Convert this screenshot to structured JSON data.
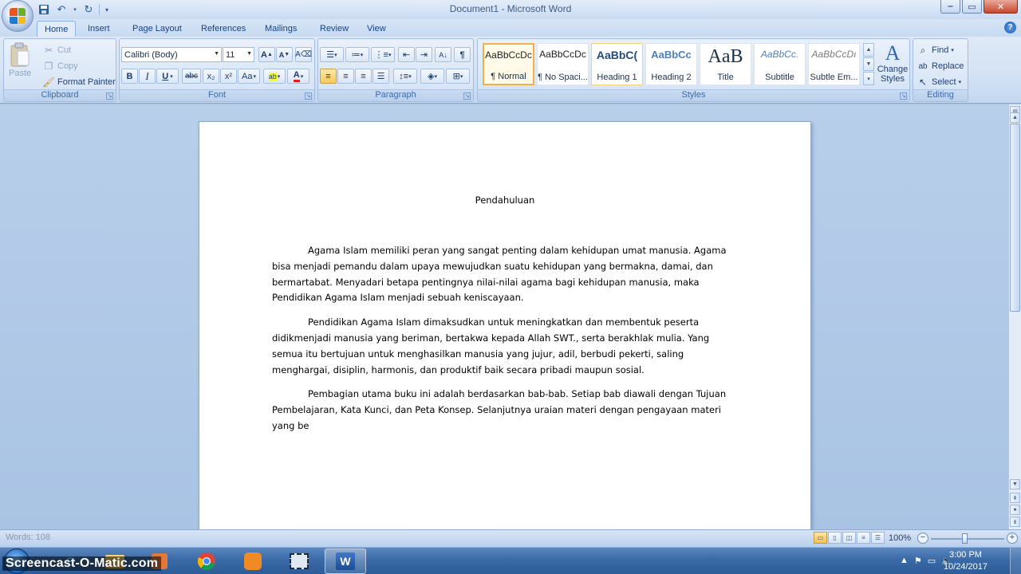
{
  "window": {
    "title": "Document1 - Microsoft Word",
    "minimize": "‒",
    "maximize": "▭",
    "close": "✕"
  },
  "tabs": [
    "Home",
    "Insert",
    "Page Layout",
    "References",
    "Mailings",
    "Review",
    "View"
  ],
  "active_tab": "Home",
  "ribbon": {
    "clipboard": {
      "label": "Clipboard",
      "paste": "Paste",
      "cut": "Cut",
      "copy": "Copy",
      "format_painter": "Format Painter"
    },
    "font": {
      "label": "Font",
      "font_name": "Calibri (Body)",
      "font_size": "11",
      "grow": "A",
      "shrink": "A",
      "bold": "B",
      "italic": "I",
      "underline": "U",
      "strike": "abc",
      "subscript": "x₂",
      "superscript": "x²",
      "change_case": "Aa",
      "highlight": "ab",
      "font_color": "A"
    },
    "paragraph": {
      "label": "Paragraph"
    },
    "styles": {
      "label": "Styles",
      "items": [
        {
          "sample": "AaBbCcDc",
          "name": "¶ Normal"
        },
        {
          "sample": "AaBbCcDc",
          "name": "¶ No Spaci..."
        },
        {
          "sample": "AaBbC(",
          "name": "Heading 1"
        },
        {
          "sample": "AaBbCc",
          "name": "Heading 2"
        },
        {
          "sample": "AaB",
          "name": "Title"
        },
        {
          "sample": "AaBbCc.",
          "name": "Subtitle"
        },
        {
          "sample": "AaBbCcDı",
          "name": "Subtle Em..."
        }
      ],
      "change_styles": "Change Styles"
    },
    "editing": {
      "label": "Editing",
      "find": "Find",
      "replace": "Replace",
      "select": "Select"
    }
  },
  "document": {
    "heading": "Pendahuluan",
    "paragraphs": [
      "Agama Islam memiliki peran yang sangat penting dalam kehidupan umat manusia. Agama bisa menjadi pemandu dalam upaya mewujudkan suatu kehidupan yang bermakna, damai, dan bermartabat. Menyadari betapa pentingnya nilai-nilai agama bagi kehidupan manusia, maka Pendidikan Agama Islam menjadi sebuah keniscayaan.",
      "Pendidikan Agama Islam dimaksudkan untuk meningkatkan dan membentuk peserta didikmenjadi manusia yang beriman, bertakwa kepada Allah SWT., serta berakhlak mulia. Yang semua itu bertujuan untuk menghasilkan manusia yang jujur, adil, berbudi pekerti, saling menghargai, disiplin, harmonis, dan produktif baik secara pribadi maupun sosial.",
      "Pembagian utama buku ini adalah berdasarkan bab-bab. Setiap bab diawali dengan Tujuan Pembelajaran, Kata Kunci, dan Peta Konsep. Selanjutnya uraian materi dengan pengayaan materi yang be"
    ]
  },
  "status": {
    "words": "Words: 108",
    "zoom": "100%",
    "zoom_fraction": 0.47
  },
  "taskbar": {
    "watermark": "Screencast-O-Matic.com",
    "time": "3:00 PM",
    "date": "10/24/2017"
  },
  "colors": {
    "ribbon_bg": "#dfe9f7",
    "workspace_bg": "#a9c3e4",
    "taskbar_bg": "#3a6aa7",
    "selected_style_border": "#f0b24a"
  }
}
